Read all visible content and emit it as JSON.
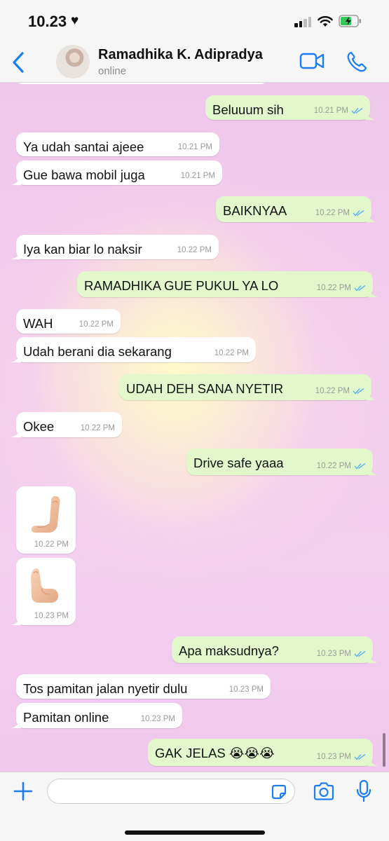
{
  "status_bar": {
    "time": "10.23",
    "heart_glyph": "♥",
    "icons": [
      "signal-icon",
      "wifi-icon",
      "battery-charging-icon"
    ]
  },
  "header": {
    "contact_name": "Ramadhika K. Adipradya",
    "contact_status": "online",
    "icons": [
      "back-chevron-icon",
      "video-call-icon",
      "phone-call-icon"
    ]
  },
  "colors": {
    "accent": "#1b7cf4",
    "bubble_in": "#ffffff",
    "bubble_out": "#e2f8cc",
    "read_ticks": "#4fa8f0",
    "wallpaper": "#f0c7ec"
  },
  "messages": [
    {
      "dir": "out",
      "text": "Beluuum sih",
      "time": "10.21 PM",
      "read": true
    },
    {
      "dir": "in",
      "text": "Ya udah santai ajeee",
      "time": "10.21 PM"
    },
    {
      "dir": "in",
      "text": "Gue bawa mobil juga",
      "time": "10.21 PM"
    },
    {
      "dir": "out",
      "text": "BAIKNYAA",
      "time": "10.22 PM",
      "read": true
    },
    {
      "dir": "in",
      "text": "Iya kan biar lo naksir",
      "time": "10.22 PM"
    },
    {
      "dir": "out",
      "text": "RAMADHIKA GUE PUKUL YA LO",
      "time": "10.22 PM",
      "read": true
    },
    {
      "dir": "in",
      "text": "WAH",
      "time": "10.22 PM"
    },
    {
      "dir": "in",
      "text": "Udah berani dia sekarang",
      "time": "10.22 PM"
    },
    {
      "dir": "out",
      "text": "UDAH DEH SANA NYETIR",
      "time": "10.22 PM",
      "read": true
    },
    {
      "dir": "in",
      "text": "Okee",
      "time": "10.22 PM"
    },
    {
      "dir": "out",
      "text": "Drive safe yaaa",
      "time": "10.22 PM",
      "read": true
    },
    {
      "dir": "in",
      "emoji": "palm-down-hand-emoji",
      "time": "10.22 PM"
    },
    {
      "dir": "in",
      "emoji": "palm-up-hand-emoji",
      "time": "10.23 PM"
    },
    {
      "dir": "out",
      "text": "Apa maksudnya?",
      "time": "10.23 PM",
      "read": true
    },
    {
      "dir": "in",
      "text": "Tos pamitan jalan nyetir dulu",
      "time": "10.23 PM"
    },
    {
      "dir": "in",
      "text": "Pamitan online",
      "time": "10.23 PM"
    },
    {
      "dir": "out",
      "text": "GAK JELAS 😭😭😭",
      "time": "10.23 PM",
      "read": true
    }
  ],
  "composer": {
    "input_value": "",
    "icons": [
      "plus-icon",
      "sticker-icon",
      "camera-icon",
      "microphone-icon"
    ]
  }
}
